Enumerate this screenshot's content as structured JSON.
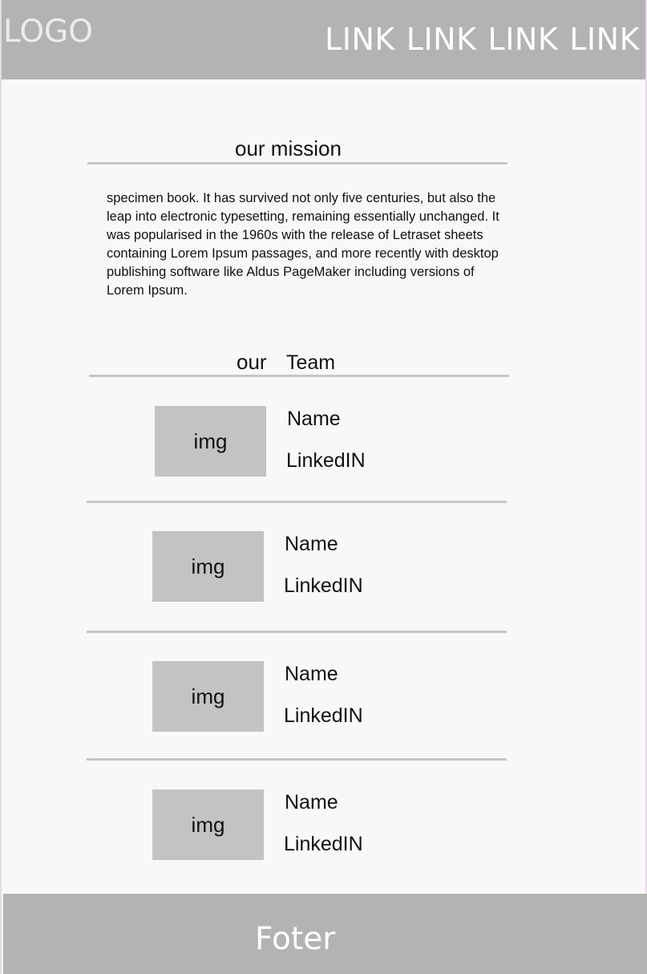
{
  "header": {
    "logo": "LOGO",
    "links": [
      "LINK",
      "LINK",
      "LINK",
      "LINK"
    ]
  },
  "mission": {
    "title": "our mission",
    "text": "specimen book. It has survived not only five centuries, but also the leap into electronic typesetting, remaining essentially unchanged. It was popularised in the 1960s with the release of Letraset sheets containing Lorem Ipsum passages, and more recently with desktop publishing software like Aldus PageMaker including versions of Lorem Ipsum."
  },
  "team": {
    "title_part1": "our",
    "title_part2": "Team",
    "members": [
      {
        "img": "img",
        "name": "Name",
        "link": "LinkedIN"
      },
      {
        "img": "img",
        "name": "Name",
        "link": "LinkedIN"
      },
      {
        "img": "img",
        "name": "Name",
        "link": "LinkedIN"
      },
      {
        "img": "img",
        "name": "Name",
        "link": "LinkedIN"
      }
    ]
  },
  "footer": {
    "text": "Foter"
  },
  "colors": {
    "bar": "#b3b3b3",
    "placeholder": "#c3c3c3",
    "background": "#f8f8f8",
    "rule": "#c6c6c6"
  }
}
